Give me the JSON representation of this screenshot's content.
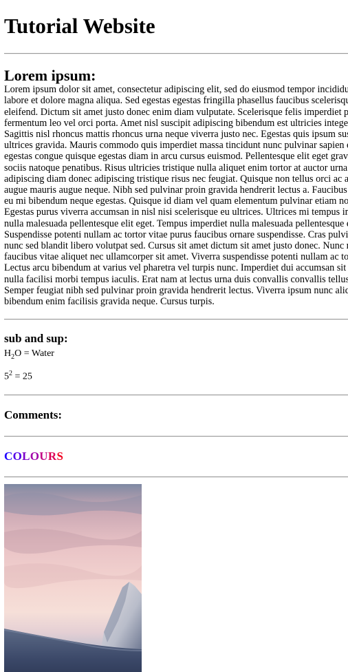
{
  "header": {
    "title": "Tutorial Website"
  },
  "lorem_section": {
    "heading": "Lorem ipsum:",
    "paragraph": "Lorem ipsum dolor sit amet, consectetur adipiscing elit, sed do eiusmod tempor incididunt ut labore et dolore magna aliqua. Sed egestas egestas fringilla phasellus faucibus scelerisque eleifend. Dictum sit amet justo donec enim diam vulputate. Scelerisque felis imperdiet proin fermentum leo vel orci porta. Amet nisl suscipit adipiscing bibendum est ultricies integer quis. Sagittis nisl rhoncus mattis rhoncus urna neque viverra justo nec. Egestas quis ipsum suspendisse ultrices gravida. Mauris commodo quis imperdiet massa tincidunt nunc pulvinar sapien et. Neque egestas congue quisque egestas diam in arcu cursus euismod. Pellentesque elit eget gravida cum sociis natoque penatibus. Risus ultricies tristique nulla aliquet enim tortor at auctor urna. Sed adipiscing diam donec adipiscing tristique risus nec feugiat. Quisque non tellus orci ac auctor augue mauris augue neque. Nibh sed pulvinar proin gravida hendrerit lectus a. Faucibus turpis in eu mi bibendum neque egestas. Quisque id diam vel quam elementum pulvinar etiam non quam. Egestas purus viverra accumsan in nisl nisi scelerisque eu ultrices. Ultrices mi tempus imperdiet nulla malesuada pellentesque elit eget. Tempus imperdiet nulla malesuada pellentesque elit eget. Suspendisse potenti nullam ac tortor vitae purus faucibus ornare suspendisse. Cras pulvinar mattis nunc sed blandit libero volutpat sed. Cursus sit amet dictum sit amet justo donec. Nunc mi ipsum faucibus vitae aliquet nec ullamcorper sit amet. Viverra suspendisse potenti nullam ac tortor. Lectus arcu bibendum at varius vel pharetra vel turpis nunc. Imperdiet dui accumsan sit amet nulla facilisi morbi tempus iaculis. Erat nam at lectus urna duis convallis convallis tellus id. Semper feugiat nibh sed pulvinar proin gravida hendrerit lectus. Viverra ipsum nunc aliquet bibendum enim facilisis gravida neque. Cursus turpis."
  },
  "sub_sup_section": {
    "heading": "sub and sup:",
    "water": {
      "base": "H",
      "sub": "2",
      "rest": "O = Water"
    },
    "square": {
      "base": "5",
      "sup": "2",
      "rest": " = 25"
    }
  },
  "comments_section": {
    "heading": "Comments:"
  },
  "colours_section": {
    "letters": [
      {
        "char": "C",
        "color": "#1f00ff"
      },
      {
        "char": "O",
        "color": "#5200e8"
      },
      {
        "char": "L",
        "color": "#7c00c8"
      },
      {
        "char": "O",
        "color": "#a000a8"
      },
      {
        "char": "U",
        "color": "#c20084"
      },
      {
        "char": "R",
        "color": "#dd0056"
      },
      {
        "char": "S",
        "color": "#f00020"
      }
    ]
  },
  "image": {
    "alt": "mountain-landscape-photo"
  }
}
